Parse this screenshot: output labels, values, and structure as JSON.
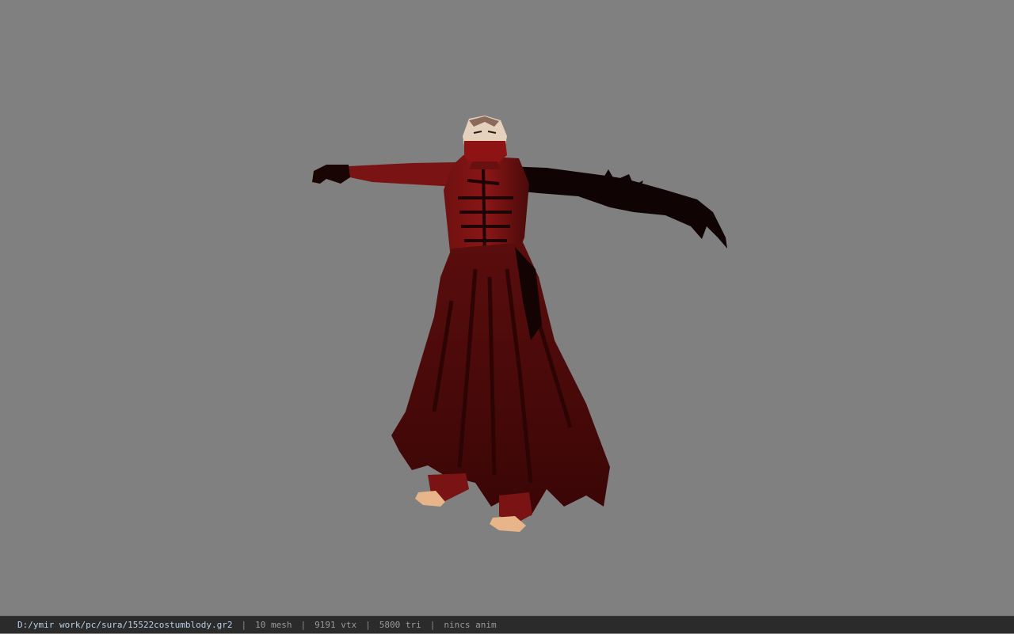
{
  "viewport": {
    "background_color": "#808080",
    "model": "sura-costume-bloody-character"
  },
  "statusbar": {
    "file_path": "D:/ymir work/pc/sura/15522costumblody.gr2",
    "mesh_count": "10 mesh",
    "vertex_count": "9191 vtx",
    "triangle_count": "5800 tri",
    "anim_status": "nincs anim",
    "separator": "|"
  }
}
